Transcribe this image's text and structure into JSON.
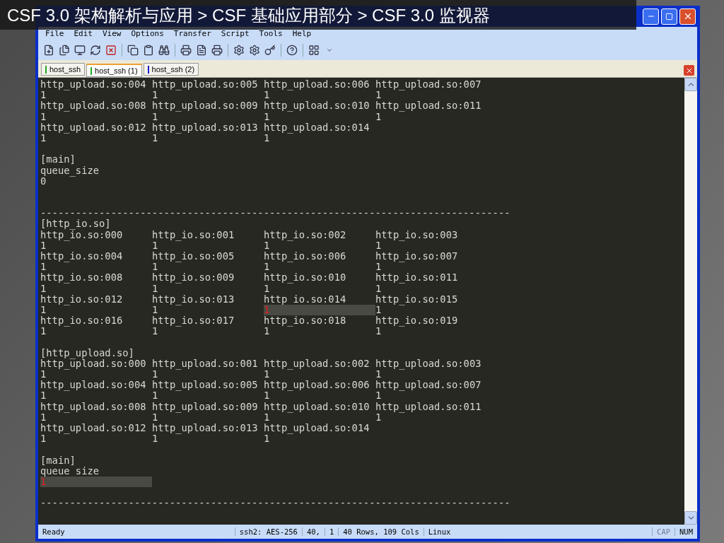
{
  "slide_header": {
    "title": "CSF 3.0 架构解析与应用 > CSF 基础应用部分 > CSF 3.0 监视器"
  },
  "menu": [
    "File",
    "Edit",
    "View",
    "Options",
    "Transfer",
    "Script",
    "Tools",
    "Help"
  ],
  "tabs": [
    {
      "label": "host_ssh",
      "selected": false,
      "color": "#22aa22"
    },
    {
      "label": "host_ssh (1)",
      "selected": true,
      "color": "#22aa22"
    },
    {
      "label": "host_ssh (2)",
      "selected": false,
      "color": "#1a1acc"
    }
  ],
  "terminal": {
    "lines": [
      {
        "kind": "cells",
        "cells": [
          {
            "text": "http_upload.so:004",
            "highlighted": false
          },
          {
            "text": "http_upload.so:005",
            "highlighted": false
          },
          {
            "text": "http_upload.so:006",
            "highlighted": false
          },
          {
            "text": "http_upload.so:007",
            "highlighted": false
          }
        ]
      },
      {
        "kind": "cells",
        "cells": [
          {
            "text": "1",
            "highlighted": false
          },
          {
            "text": "1",
            "highlighted": false
          },
          {
            "text": "1",
            "highlighted": false
          },
          {
            "text": "1",
            "highlighted": false
          }
        ]
      },
      {
        "kind": "cells",
        "cells": [
          {
            "text": "http_upload.so:008",
            "highlighted": false
          },
          {
            "text": "http_upload.so:009",
            "highlighted": false
          },
          {
            "text": "http_upload.so:010",
            "highlighted": false
          },
          {
            "text": "http_upload.so:011",
            "highlighted": false
          }
        ]
      },
      {
        "kind": "cells",
        "cells": [
          {
            "text": "1",
            "highlighted": false
          },
          {
            "text": "1",
            "highlighted": false
          },
          {
            "text": "1",
            "highlighted": false
          },
          {
            "text": "1",
            "highlighted": false
          }
        ]
      },
      {
        "kind": "cells",
        "cells": [
          {
            "text": "http_upload.so:012",
            "highlighted": false
          },
          {
            "text": "http_upload.so:013",
            "highlighted": false
          },
          {
            "text": "http_upload.so:014",
            "highlighted": false
          }
        ]
      },
      {
        "kind": "cells",
        "cells": [
          {
            "text": "1",
            "highlighted": false
          },
          {
            "text": "1",
            "highlighted": false
          },
          {
            "text": "1",
            "highlighted": false
          }
        ]
      },
      {
        "kind": "blank"
      },
      {
        "kind": "text",
        "text": "[main]"
      },
      {
        "kind": "text",
        "text": "queue_size"
      },
      {
        "kind": "text",
        "text": "0"
      },
      {
        "kind": "blank"
      },
      {
        "kind": "blank"
      },
      {
        "kind": "text",
        "text": "--------------------------------------------------------------------------------"
      },
      {
        "kind": "text",
        "text": "[http_io.so]"
      },
      {
        "kind": "cells",
        "cells": [
          {
            "text": "http_io.so:000",
            "highlighted": false
          },
          {
            "text": "http_io.so:001",
            "highlighted": false
          },
          {
            "text": "http_io.so:002",
            "highlighted": false
          },
          {
            "text": "http_io.so:003",
            "highlighted": false
          }
        ]
      },
      {
        "kind": "cells",
        "cells": [
          {
            "text": "1",
            "highlighted": false
          },
          {
            "text": "1",
            "highlighted": false
          },
          {
            "text": "1",
            "highlighted": false
          },
          {
            "text": "1",
            "highlighted": false
          }
        ]
      },
      {
        "kind": "cells",
        "cells": [
          {
            "text": "http_io.so:004",
            "highlighted": false
          },
          {
            "text": "http_io.so:005",
            "highlighted": false
          },
          {
            "text": "http_io.so:006",
            "highlighted": false
          },
          {
            "text": "http_io.so:007",
            "highlighted": false
          }
        ]
      },
      {
        "kind": "cells",
        "cells": [
          {
            "text": "1",
            "highlighted": false
          },
          {
            "text": "1",
            "highlighted": false
          },
          {
            "text": "1",
            "highlighted": false
          },
          {
            "text": "1",
            "highlighted": false
          }
        ]
      },
      {
        "kind": "cells",
        "cells": [
          {
            "text": "http_io.so:008",
            "highlighted": false
          },
          {
            "text": "http_io.so:009",
            "highlighted": false
          },
          {
            "text": "http_io.so:010",
            "highlighted": false
          },
          {
            "text": "http_io.so:011",
            "highlighted": false
          }
        ]
      },
      {
        "kind": "cells",
        "cells": [
          {
            "text": "1",
            "highlighted": false
          },
          {
            "text": "1",
            "highlighted": false
          },
          {
            "text": "1",
            "highlighted": false
          },
          {
            "text": "1",
            "highlighted": false
          }
        ]
      },
      {
        "kind": "cells",
        "cells": [
          {
            "text": "http_io.so:012",
            "highlighted": false
          },
          {
            "text": "http_io.so:013",
            "highlighted": false
          },
          {
            "text": "http_io.so:014",
            "highlighted": false
          },
          {
            "text": "http_io.so:015",
            "highlighted": false
          }
        ]
      },
      {
        "kind": "cells",
        "cells": [
          {
            "text": "1",
            "highlighted": false
          },
          {
            "text": "1",
            "highlighted": false
          },
          {
            "text": "1",
            "highlighted": true
          },
          {
            "text": "1",
            "highlighted": false
          }
        ]
      },
      {
        "kind": "cells",
        "cells": [
          {
            "text": "http_io.so:016",
            "highlighted": false
          },
          {
            "text": "http_io.so:017",
            "highlighted": false
          },
          {
            "text": "http_io.so:018",
            "highlighted": false
          },
          {
            "text": "http_io.so:019",
            "highlighted": false
          }
        ]
      },
      {
        "kind": "cells",
        "cells": [
          {
            "text": "1",
            "highlighted": false
          },
          {
            "text": "1",
            "highlighted": false
          },
          {
            "text": "1",
            "highlighted": false
          },
          {
            "text": "1",
            "highlighted": false
          }
        ]
      },
      {
        "kind": "blank"
      },
      {
        "kind": "text",
        "text": "[http_upload.so]"
      },
      {
        "kind": "cells",
        "cells": [
          {
            "text": "http_upload.so:000",
            "highlighted": false
          },
          {
            "text": "http_upload.so:001",
            "highlighted": false
          },
          {
            "text": "http_upload.so:002",
            "highlighted": false
          },
          {
            "text": "http_upload.so:003",
            "highlighted": false
          }
        ]
      },
      {
        "kind": "cells",
        "cells": [
          {
            "text": "1",
            "highlighted": false
          },
          {
            "text": "1",
            "highlighted": false
          },
          {
            "text": "1",
            "highlighted": false
          },
          {
            "text": "1",
            "highlighted": false
          }
        ]
      },
      {
        "kind": "cells",
        "cells": [
          {
            "text": "http_upload.so:004",
            "highlighted": false
          },
          {
            "text": "http_upload.so:005",
            "highlighted": false
          },
          {
            "text": "http_upload.so:006",
            "highlighted": false
          },
          {
            "text": "http_upload.so:007",
            "highlighted": false
          }
        ]
      },
      {
        "kind": "cells",
        "cells": [
          {
            "text": "1",
            "highlighted": false
          },
          {
            "text": "1",
            "highlighted": false
          },
          {
            "text": "1",
            "highlighted": false
          },
          {
            "text": "1",
            "highlighted": false
          }
        ]
      },
      {
        "kind": "cells",
        "cells": [
          {
            "text": "http_upload.so:008",
            "highlighted": false
          },
          {
            "text": "http_upload.so:009",
            "highlighted": false
          },
          {
            "text": "http_upload.so:010",
            "highlighted": false
          },
          {
            "text": "http_upload.so:011",
            "highlighted": false
          }
        ]
      },
      {
        "kind": "cells",
        "cells": [
          {
            "text": "1",
            "highlighted": false
          },
          {
            "text": "1",
            "highlighted": false
          },
          {
            "text": "1",
            "highlighted": false
          },
          {
            "text": "1",
            "highlighted": false
          }
        ]
      },
      {
        "kind": "cells",
        "cells": [
          {
            "text": "http_upload.so:012",
            "highlighted": false
          },
          {
            "text": "http_upload.so:013",
            "highlighted": false
          },
          {
            "text": "http_upload.so:014",
            "highlighted": false
          }
        ]
      },
      {
        "kind": "cells",
        "cells": [
          {
            "text": "1",
            "highlighted": false
          },
          {
            "text": "1",
            "highlighted": false
          },
          {
            "text": "1",
            "highlighted": false
          }
        ]
      },
      {
        "kind": "blank"
      },
      {
        "kind": "text",
        "text": "[main]"
      },
      {
        "kind": "text",
        "text": "queue_size"
      },
      {
        "kind": "cells",
        "cells": [
          {
            "text": "1",
            "highlighted": true
          }
        ]
      },
      {
        "kind": "blank"
      },
      {
        "kind": "text",
        "text": "--------------------------------------------------------------------------------"
      }
    ]
  },
  "status_bar": [
    {
      "text": "Ready",
      "on": true
    },
    {
      "text": "ssh2: AES-256",
      "on": true
    },
    {
      "text": "40,",
      "on": true
    },
    {
      "text": "1",
      "on": true
    },
    {
      "text": "40 Rows, 109 Cols",
      "on": true
    },
    {
      "text": "Linux",
      "on": true
    },
    {
      "text": "CAP",
      "on": false
    },
    {
      "text": "NUM",
      "on": true
    }
  ]
}
